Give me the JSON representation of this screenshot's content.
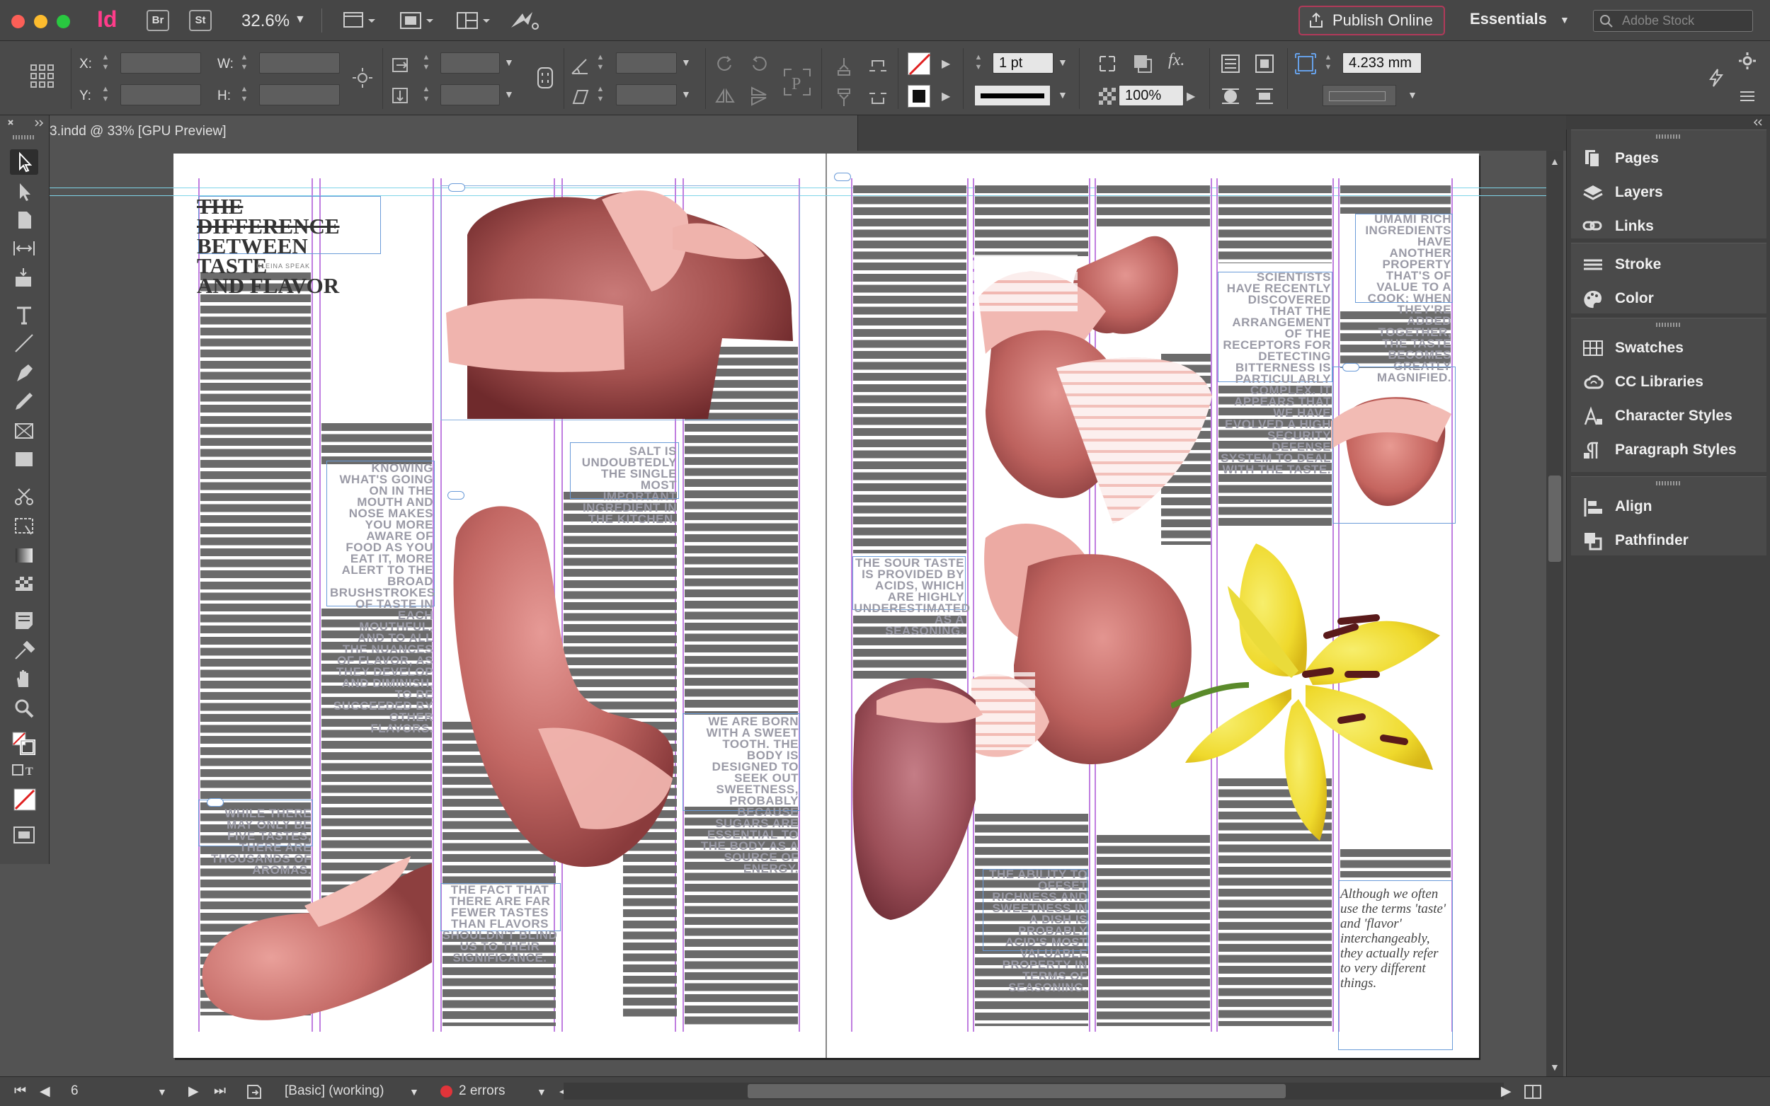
{
  "app": {
    "logo": "Id",
    "bridge_label": "Br",
    "stock_label": "St",
    "zoom": "32.6%",
    "publish_label": "Publish Online",
    "workspace": "Essentials",
    "search_placeholder": "Adobe Stock"
  },
  "control": {
    "x_label": "X:",
    "y_label": "Y:",
    "w_label": "W:",
    "h_label": "H:",
    "stroke_weight": "1 pt",
    "opacity": "100%",
    "offset": "4.233 mm"
  },
  "document": {
    "tab_title": "3.indd @ 33% [GPU Preview]",
    "headline_line1": "THE DIFFERENCE",
    "headline_line2": "BETWEEN TASTE",
    "headline_line3": "AND FLAVOR",
    "byline": "KLEINA SPEAK",
    "pull_quotes": {
      "knowing": "KNOWING WHAT'S GOING ON IN THE MOUTH AND NOSE MAKES YOU MORE AWARE OF FOOD AS YOU EAT IT, MORE ALERT TO THE BROAD BRUSHSTROKES OF TASTE IN EACH MOUTHFUL, AND TO ALL THE NUANCES OF FLAVOR, AS THEY DEVELOP AND DIMINISH, TO BE SUCCEEDED BY OTHER FLAVORS.",
      "salt": "SALT IS UNDOUBTEDLY THE SINGLE MOST IMPORTANT INGREDIENT IN THE KITCHEN.",
      "sweet": "WE ARE BORN WITH A SWEET TOOTH. THE BODY IS DESIGNED TO SEEK OUT SWEETNESS, PROBABLY BECAUSE SUGARS ARE ESSENTIAL TO THE BODY AS A SOURCE OF ENERGY.",
      "five": "WHILE THERE MAY ONLY BE FIVE TASTES, THERE ARE THOUSANDS OF AROMAS.",
      "fewer": "THE FACT THAT THERE ARE FAR FEWER TASTES THAN FLAVORS SHOULDN'T BLIND US TO THEIR SIGNIFICANCE.",
      "sour": "THE SOUR TASTE IS PROVIDED BY ACIDS, WHICH ARE HIGHLY UNDERESTIMATED AS A SEASONING.",
      "bitter": "SCIENTISTS HAVE RECENTLY DISCOVERED THAT THE ARRANGEMENT OF THE RECEPTORS FOR DETECTING BITTERNESS IS PARTICULARLY COMPLEX. IT APPEARS THAT WE HAVE EVOLVED A HIGH SECURITY DEFENSE SYSTEM TO DEAL WITH THE TASTE.",
      "umami": "UMAMI RICH INGREDIENTS HAVE ANOTHER PROPERTY THAT'S OF VALUE TO A COOK: WHEN THEY'RE ADDED TOGETHER, THE TASTE BECOMES GREATLY MAGNIFIED.",
      "acid": "THE ABILITY TO OFFSET RICHNESS AND SWEETNESS IN A DISH IS PROBABLY ACID'S MOST VALUABLE PROPERTY IN TERMS OF SEASONING."
    },
    "italic_quote": "Although we often use the terms 'taste' and 'flavor' interchangeably, they actually refer to very different things."
  },
  "panels": {
    "pages": "Pages",
    "layers": "Layers",
    "links": "Links",
    "stroke": "Stroke",
    "color": "Color",
    "swatches": "Swatches",
    "cc_libraries": "CC Libraries",
    "character_styles": "Character Styles",
    "paragraph_styles": "Paragraph Styles",
    "align": "Align",
    "pathfinder": "Pathfinder"
  },
  "status": {
    "page_number": "6",
    "preflight_profile": "[Basic] (working)",
    "errors": "2 errors"
  },
  "colors": {
    "accent_pink": "#ff3c8a",
    "frame_purple": "#c07ee0",
    "frame_blue": "#6a9bd8",
    "error_red": "#e0343a",
    "lily_yellow": "#f2e23c"
  }
}
